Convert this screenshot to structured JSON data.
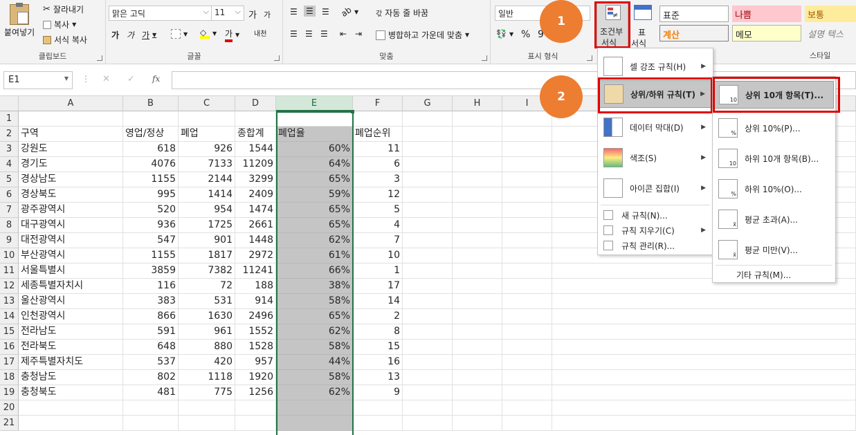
{
  "ribbon": {
    "clipboard": {
      "paste": "붙여넣기",
      "cut": "잘라내기",
      "copy": "복사",
      "format_painter": "서식 복사",
      "label": "클립보드"
    },
    "font": {
      "name": "맑은 고딕",
      "size": "11",
      "grow": "가",
      "shrink": "가",
      "bold": "가",
      "italic": "가",
      "underline": "가",
      "label": "글꼴",
      "phonetic": "내천"
    },
    "alignment": {
      "wrap": "자동 줄 바꿈",
      "merge": "병합하고 가운데 맞춤",
      "label": "맞춤"
    },
    "number": {
      "format": "일반",
      "percent": "%",
      "comma": "9",
      "label": "표시 형식"
    },
    "conditional": {
      "line1": "조건부",
      "line2": "서식"
    },
    "table_format": {
      "line1": "표",
      "line2": "서식"
    },
    "styles": {
      "normal": "표준",
      "bad": "나쁨",
      "neutral": "보통",
      "calc": "계산",
      "memo": "메모",
      "explanatory": "설명 텍스",
      "label": "스타일"
    }
  },
  "callouts": [
    "1",
    "2"
  ],
  "formula_bar": {
    "name_box": "E1",
    "fx": "fx",
    "cancel": "✕",
    "enter": "✓"
  },
  "columns": [
    "A",
    "B",
    "C",
    "D",
    "E",
    "F",
    "G",
    "H",
    "I"
  ],
  "rows": [
    "1",
    "2",
    "3",
    "4",
    "5",
    "6",
    "7",
    "8",
    "9",
    "10",
    "11",
    "12",
    "13",
    "14",
    "15",
    "16",
    "17",
    "18",
    "19",
    "20",
    "21"
  ],
  "table": {
    "headers": [
      "구역",
      "영업/정상",
      "폐업",
      "종합계",
      "폐업율",
      "폐업순위"
    ],
    "data": [
      [
        "강원도",
        "618",
        "926",
        "1544",
        "60%",
        "11"
      ],
      [
        "경기도",
        "4076",
        "7133",
        "11209",
        "64%",
        "6"
      ],
      [
        "경상남도",
        "1155",
        "2144",
        "3299",
        "65%",
        "3"
      ],
      [
        "경상북도",
        "995",
        "1414",
        "2409",
        "59%",
        "12"
      ],
      [
        "광주광역시",
        "520",
        "954",
        "1474",
        "65%",
        "5"
      ],
      [
        "대구광역시",
        "936",
        "1725",
        "2661",
        "65%",
        "4"
      ],
      [
        "대전광역시",
        "547",
        "901",
        "1448",
        "62%",
        "7"
      ],
      [
        "부산광역시",
        "1155",
        "1817",
        "2972",
        "61%",
        "10"
      ],
      [
        "서울특별시",
        "3859",
        "7382",
        "11241",
        "66%",
        "1"
      ],
      [
        "세종특별자치시",
        "116",
        "72",
        "188",
        "38%",
        "17"
      ],
      [
        "울산광역시",
        "383",
        "531",
        "914",
        "58%",
        "14"
      ],
      [
        "인천광역시",
        "866",
        "1630",
        "2496",
        "65%",
        "2"
      ],
      [
        "전라남도",
        "591",
        "961",
        "1552",
        "62%",
        "8"
      ],
      [
        "전라북도",
        "648",
        "880",
        "1528",
        "58%",
        "15"
      ],
      [
        "제주특별자치도",
        "537",
        "420",
        "957",
        "44%",
        "16"
      ],
      [
        "충청남도",
        "802",
        "1118",
        "1920",
        "58%",
        "13"
      ],
      [
        "충청북도",
        "481",
        "775",
        "1256",
        "62%",
        "9"
      ]
    ]
  },
  "menu_main": {
    "items": [
      "셀 강조 규칙(H)",
      "상위/하위 규칙(T)",
      "데이터 막대(D)",
      "색조(S)",
      "아이콘 집합(I)"
    ],
    "small_items": [
      "새 규칙(N)...",
      "규칙 지우기(C)",
      "규칙 관리(R)..."
    ]
  },
  "menu_sub": {
    "items": [
      "상위 10개 항목(T)...",
      "상위 10%(P)...",
      "하위 10개 항목(B)...",
      "하위 10%(O)...",
      "평균 초과(A)...",
      "평균 미만(V)..."
    ],
    "more": "기타 규칙(M)...",
    "icon_text": [
      "10",
      "%",
      "10",
      "%",
      "x̄",
      "x̄"
    ]
  },
  "colors": {
    "accent_green": "#217346",
    "highlight_red": "#e00000",
    "callout_orange": "#ed7d31",
    "selection_gray": "#c5c5c5"
  }
}
